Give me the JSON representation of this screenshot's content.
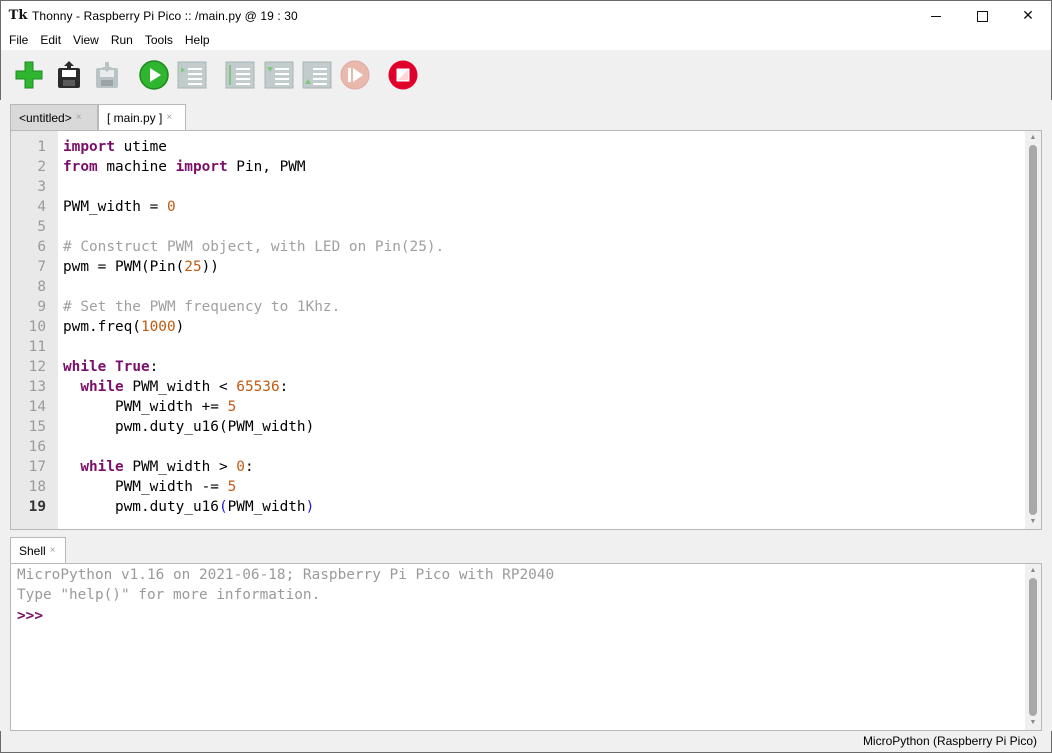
{
  "window": {
    "app_icon": "Tk",
    "title": "Thonny  -  Raspberry Pi Pico :: /main.py  @  19 : 30",
    "minimize_icon": "minimize-icon",
    "maximize_icon": "maximize-icon",
    "close_glyph": "✕"
  },
  "menu": {
    "items": [
      "File",
      "Edit",
      "View",
      "Run",
      "Tools",
      "Help"
    ]
  },
  "toolbar": {
    "buttons": [
      {
        "name": "new-file-icon",
        "enabled": true
      },
      {
        "name": "open-file-icon",
        "enabled": true
      },
      {
        "name": "save-file-icon",
        "enabled": false
      },
      {
        "name": "run-icon",
        "enabled": true
      },
      {
        "name": "debug-icon",
        "enabled": false
      },
      {
        "name": "step-over-icon",
        "enabled": false
      },
      {
        "name": "step-into-icon",
        "enabled": false
      },
      {
        "name": "step-out-icon",
        "enabled": false
      },
      {
        "name": "resume-icon",
        "enabled": false
      },
      {
        "name": "stop-icon",
        "enabled": true
      }
    ],
    "colors": {
      "green": "#2fb52f",
      "red": "#e0002b",
      "disabled": "#b9c3c5"
    }
  },
  "editor": {
    "tabs": [
      {
        "label": "<untitled>",
        "close": "×",
        "active": false
      },
      {
        "label": "[ main.py ]",
        "close": "×",
        "active": true
      }
    ],
    "current_line": 19,
    "lines": [
      [
        [
          "kw",
          "import"
        ],
        [
          "tx",
          " utime"
        ]
      ],
      [
        [
          "kw",
          "from"
        ],
        [
          "tx",
          " machine "
        ],
        [
          "kw",
          "import"
        ],
        [
          "tx",
          " Pin, PWM"
        ]
      ],
      [],
      [
        [
          "tx",
          "PWM_width = "
        ],
        [
          "num",
          "0"
        ]
      ],
      [],
      [
        [
          "cm",
          "# Construct PWM object, with LED on Pin(25)."
        ]
      ],
      [
        [
          "tx",
          "pwm = PWM(Pin("
        ],
        [
          "num",
          "25"
        ],
        [
          "tx",
          "))"
        ]
      ],
      [],
      [
        [
          "cm",
          "# Set the PWM frequency to 1Khz."
        ]
      ],
      [
        [
          "tx",
          "pwm.freq("
        ],
        [
          "num",
          "1000"
        ],
        [
          "tx",
          ")"
        ]
      ],
      [],
      [
        [
          "kw",
          "while"
        ],
        [
          "tx",
          " "
        ],
        [
          "kw",
          "True"
        ],
        [
          "tx",
          ":"
        ]
      ],
      [
        [
          "tx",
          "  "
        ],
        [
          "kw",
          "while"
        ],
        [
          "tx",
          " PWM_width < "
        ],
        [
          "num",
          "65536"
        ],
        [
          "tx",
          ":"
        ]
      ],
      [
        [
          "tx",
          "      PWM_width += "
        ],
        [
          "num",
          "5"
        ]
      ],
      [
        [
          "tx",
          "      pwm.duty_u16(PWM_width)"
        ]
      ],
      [],
      [
        [
          "tx",
          "  "
        ],
        [
          "kw",
          "while"
        ],
        [
          "tx",
          " PWM_width > "
        ],
        [
          "num",
          "0"
        ],
        [
          "tx",
          ":"
        ]
      ],
      [
        [
          "tx",
          "      PWM_width -= "
        ],
        [
          "num",
          "5"
        ]
      ],
      [
        [
          "tx",
          "      pwm.duty_u16"
        ],
        [
          "par",
          "("
        ],
        [
          "tx",
          "PWM_width"
        ],
        [
          "par",
          ")"
        ]
      ]
    ]
  },
  "shell": {
    "tab_label": "Shell",
    "tab_close": "×",
    "banner_line1": "MicroPython v1.16 on 2021-06-18; Raspberry Pi Pico with RP2040",
    "banner_line2": "Type \"help()\" for more information.",
    "prompt": ">>>"
  },
  "status": {
    "interpreter": "MicroPython (Raspberry Pi Pico)"
  }
}
